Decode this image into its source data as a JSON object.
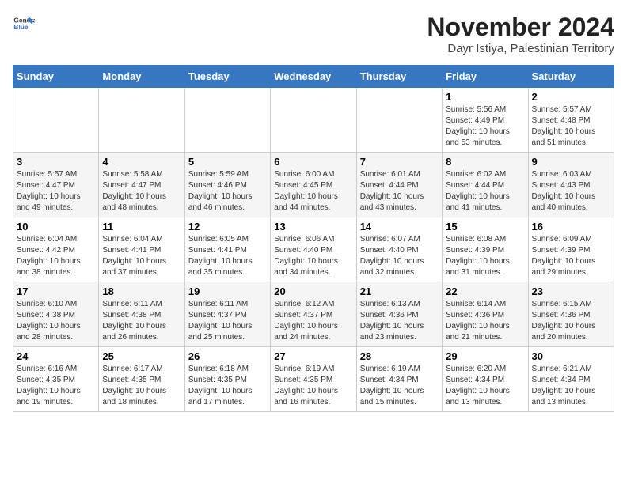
{
  "header": {
    "logo_line1": "General",
    "logo_line2": "Blue",
    "month": "November 2024",
    "location": "Dayr Istiya, Palestinian Territory"
  },
  "weekdays": [
    "Sunday",
    "Monday",
    "Tuesday",
    "Wednesday",
    "Thursday",
    "Friday",
    "Saturday"
  ],
  "weeks": [
    [
      {
        "day": "",
        "info": ""
      },
      {
        "day": "",
        "info": ""
      },
      {
        "day": "",
        "info": ""
      },
      {
        "day": "",
        "info": ""
      },
      {
        "day": "",
        "info": ""
      },
      {
        "day": "1",
        "info": "Sunrise: 5:56 AM\nSunset: 4:49 PM\nDaylight: 10 hours and 53 minutes."
      },
      {
        "day": "2",
        "info": "Sunrise: 5:57 AM\nSunset: 4:48 PM\nDaylight: 10 hours and 51 minutes."
      }
    ],
    [
      {
        "day": "3",
        "info": "Sunrise: 5:57 AM\nSunset: 4:47 PM\nDaylight: 10 hours and 49 minutes."
      },
      {
        "day": "4",
        "info": "Sunrise: 5:58 AM\nSunset: 4:47 PM\nDaylight: 10 hours and 48 minutes."
      },
      {
        "day": "5",
        "info": "Sunrise: 5:59 AM\nSunset: 4:46 PM\nDaylight: 10 hours and 46 minutes."
      },
      {
        "day": "6",
        "info": "Sunrise: 6:00 AM\nSunset: 4:45 PM\nDaylight: 10 hours and 44 minutes."
      },
      {
        "day": "7",
        "info": "Sunrise: 6:01 AM\nSunset: 4:44 PM\nDaylight: 10 hours and 43 minutes."
      },
      {
        "day": "8",
        "info": "Sunrise: 6:02 AM\nSunset: 4:44 PM\nDaylight: 10 hours and 41 minutes."
      },
      {
        "day": "9",
        "info": "Sunrise: 6:03 AM\nSunset: 4:43 PM\nDaylight: 10 hours and 40 minutes."
      }
    ],
    [
      {
        "day": "10",
        "info": "Sunrise: 6:04 AM\nSunset: 4:42 PM\nDaylight: 10 hours and 38 minutes."
      },
      {
        "day": "11",
        "info": "Sunrise: 6:04 AM\nSunset: 4:41 PM\nDaylight: 10 hours and 37 minutes."
      },
      {
        "day": "12",
        "info": "Sunrise: 6:05 AM\nSunset: 4:41 PM\nDaylight: 10 hours and 35 minutes."
      },
      {
        "day": "13",
        "info": "Sunrise: 6:06 AM\nSunset: 4:40 PM\nDaylight: 10 hours and 34 minutes."
      },
      {
        "day": "14",
        "info": "Sunrise: 6:07 AM\nSunset: 4:40 PM\nDaylight: 10 hours and 32 minutes."
      },
      {
        "day": "15",
        "info": "Sunrise: 6:08 AM\nSunset: 4:39 PM\nDaylight: 10 hours and 31 minutes."
      },
      {
        "day": "16",
        "info": "Sunrise: 6:09 AM\nSunset: 4:39 PM\nDaylight: 10 hours and 29 minutes."
      }
    ],
    [
      {
        "day": "17",
        "info": "Sunrise: 6:10 AM\nSunset: 4:38 PM\nDaylight: 10 hours and 28 minutes."
      },
      {
        "day": "18",
        "info": "Sunrise: 6:11 AM\nSunset: 4:38 PM\nDaylight: 10 hours and 26 minutes."
      },
      {
        "day": "19",
        "info": "Sunrise: 6:11 AM\nSunset: 4:37 PM\nDaylight: 10 hours and 25 minutes."
      },
      {
        "day": "20",
        "info": "Sunrise: 6:12 AM\nSunset: 4:37 PM\nDaylight: 10 hours and 24 minutes."
      },
      {
        "day": "21",
        "info": "Sunrise: 6:13 AM\nSunset: 4:36 PM\nDaylight: 10 hours and 23 minutes."
      },
      {
        "day": "22",
        "info": "Sunrise: 6:14 AM\nSunset: 4:36 PM\nDaylight: 10 hours and 21 minutes."
      },
      {
        "day": "23",
        "info": "Sunrise: 6:15 AM\nSunset: 4:36 PM\nDaylight: 10 hours and 20 minutes."
      }
    ],
    [
      {
        "day": "24",
        "info": "Sunrise: 6:16 AM\nSunset: 4:35 PM\nDaylight: 10 hours and 19 minutes."
      },
      {
        "day": "25",
        "info": "Sunrise: 6:17 AM\nSunset: 4:35 PM\nDaylight: 10 hours and 18 minutes."
      },
      {
        "day": "26",
        "info": "Sunrise: 6:18 AM\nSunset: 4:35 PM\nDaylight: 10 hours and 17 minutes."
      },
      {
        "day": "27",
        "info": "Sunrise: 6:19 AM\nSunset: 4:35 PM\nDaylight: 10 hours and 16 minutes."
      },
      {
        "day": "28",
        "info": "Sunrise: 6:19 AM\nSunset: 4:34 PM\nDaylight: 10 hours and 15 minutes."
      },
      {
        "day": "29",
        "info": "Sunrise: 6:20 AM\nSunset: 4:34 PM\nDaylight: 10 hours and 13 minutes."
      },
      {
        "day": "30",
        "info": "Sunrise: 6:21 AM\nSunset: 4:34 PM\nDaylight: 10 hours and 13 minutes."
      }
    ]
  ]
}
